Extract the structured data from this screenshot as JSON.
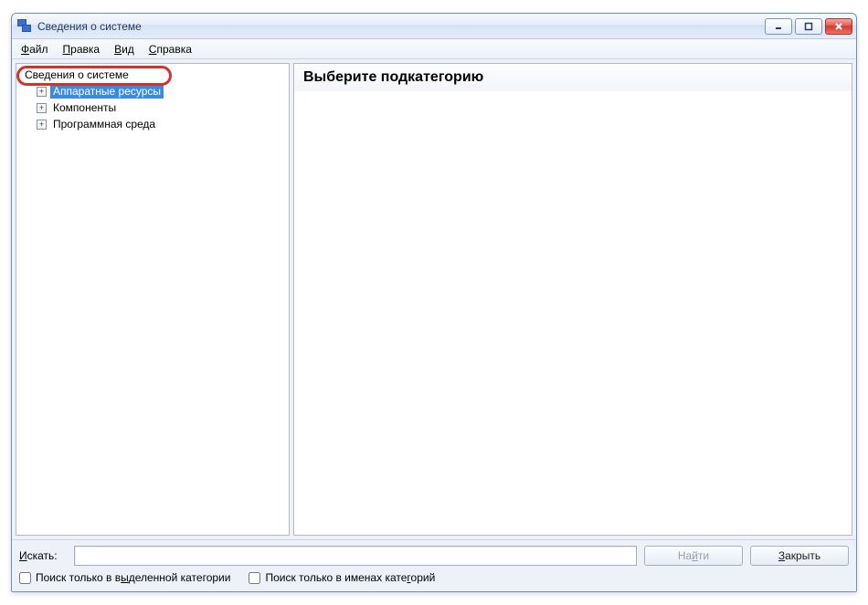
{
  "window": {
    "title": "Сведения о системе"
  },
  "menubar": {
    "items": [
      {
        "pre": "",
        "u": "Ф",
        "post": "айл"
      },
      {
        "pre": "",
        "u": "П",
        "post": "равка"
      },
      {
        "pre": "",
        "u": "В",
        "post": "ид"
      },
      {
        "pre": "",
        "u": "С",
        "post": "правка"
      }
    ]
  },
  "tree": {
    "root": "Сведения о системе",
    "children": [
      {
        "label": "Аппаратные ресурсы",
        "selected": true
      },
      {
        "label": "Компоненты",
        "selected": false
      },
      {
        "label": "Программная среда",
        "selected": false
      }
    ]
  },
  "detail": {
    "header": "Выберите подкатегорию"
  },
  "search": {
    "label_pre": "",
    "label_u": "И",
    "label_post": "скать:",
    "value": "",
    "find_btn": {
      "pre": "На",
      "u": "й",
      "post": "ти"
    },
    "close_btn": {
      "pre": "",
      "u": "З",
      "post": "акрыть"
    }
  },
  "checks": {
    "cat": {
      "pre": "Поиск только в в",
      "u": "ы",
      "post": "деленной категории"
    },
    "names": {
      "pre": "Поиск только в именах кате",
      "u": "г",
      "post": "орий"
    }
  }
}
